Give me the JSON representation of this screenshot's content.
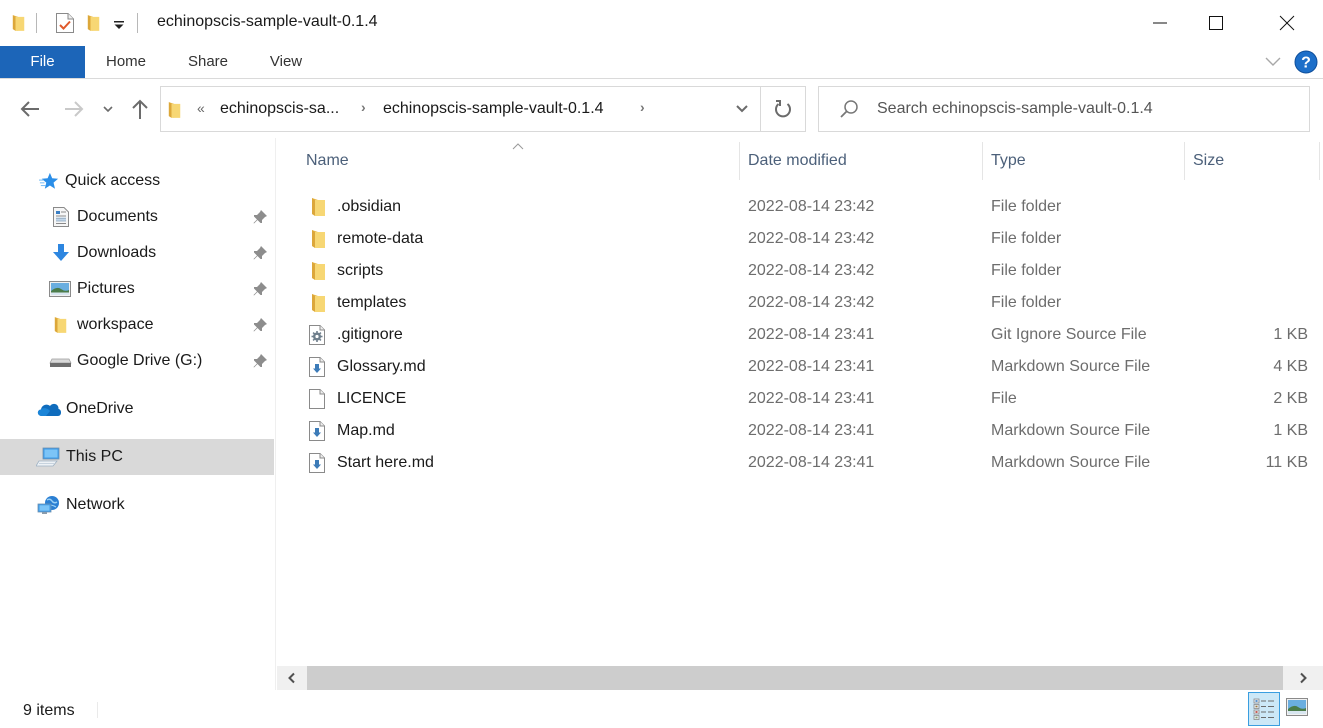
{
  "window": {
    "title": "echinopscis-sample-vault-0.1.4",
    "controls": {
      "minimize": "minimize",
      "maximize": "maximize",
      "close": "close"
    }
  },
  "ribbon": {
    "tabs": [
      {
        "label": "File",
        "active": true
      },
      {
        "label": "Home"
      },
      {
        "label": "Share"
      },
      {
        "label": "View"
      }
    ],
    "accent_color": "#1c65b8"
  },
  "address_bar": {
    "overflow_glyph": "«",
    "crumbs": [
      "echinopscis-sa...",
      "echinopscis-sample-vault-0.1.4"
    ],
    "separator_glyph": "›"
  },
  "search": {
    "placeholder": "Search echinopscis-sample-vault-0.1.4"
  },
  "sidebar": {
    "items": [
      {
        "label": "Quick access",
        "icon": "star-icon"
      },
      {
        "label": "Documents",
        "icon": "documents-icon",
        "pinned": true
      },
      {
        "label": "Downloads",
        "icon": "download-arrow-icon",
        "pinned": true
      },
      {
        "label": "Pictures",
        "icon": "pictures-icon",
        "pinned": true
      },
      {
        "label": "workspace",
        "icon": "folder-icon",
        "pinned": true
      },
      {
        "label": "Google Drive (G:)",
        "icon": "drive-icon",
        "pinned": true
      },
      {
        "label": "OneDrive",
        "icon": "cloud-icon"
      },
      {
        "label": "This PC",
        "icon": "computer-icon",
        "selected": true
      },
      {
        "label": "Network",
        "icon": "network-icon"
      }
    ]
  },
  "file_list": {
    "columns": [
      "Name",
      "Date modified",
      "Type",
      "Size"
    ],
    "sorted_by": "Name",
    "rows": [
      {
        "name": ".obsidian",
        "date": "2022-08-14 23:42",
        "type": "File folder",
        "size": "",
        "icon": "folder-icon"
      },
      {
        "name": "remote-data",
        "date": "2022-08-14 23:42",
        "type": "File folder",
        "size": "",
        "icon": "folder-icon"
      },
      {
        "name": "scripts",
        "date": "2022-08-14 23:42",
        "type": "File folder",
        "size": "",
        "icon": "folder-icon"
      },
      {
        "name": "templates",
        "date": "2022-08-14 23:42",
        "type": "File folder",
        "size": "",
        "icon": "folder-icon"
      },
      {
        "name": ".gitignore",
        "date": "2022-08-14 23:41",
        "type": "Git Ignore Source File",
        "size": "1 KB",
        "icon": "settings-file-icon"
      },
      {
        "name": "Glossary.md",
        "date": "2022-08-14 23:41",
        "type": "Markdown Source File",
        "size": "4 KB",
        "icon": "markdown-file-icon"
      },
      {
        "name": "LICENCE",
        "date": "2022-08-14 23:41",
        "type": "File",
        "size": "2 KB",
        "icon": "blank-file-icon"
      },
      {
        "name": "Map.md",
        "date": "2022-08-14 23:41",
        "type": "Markdown Source File",
        "size": "1 KB",
        "icon": "markdown-file-icon"
      },
      {
        "name": "Start here.md",
        "date": "2022-08-14 23:41",
        "type": "Markdown Source File",
        "size": "11 KB",
        "icon": "markdown-file-icon"
      }
    ]
  },
  "status_bar": {
    "item_count": "9 items",
    "view_mode": "details"
  }
}
